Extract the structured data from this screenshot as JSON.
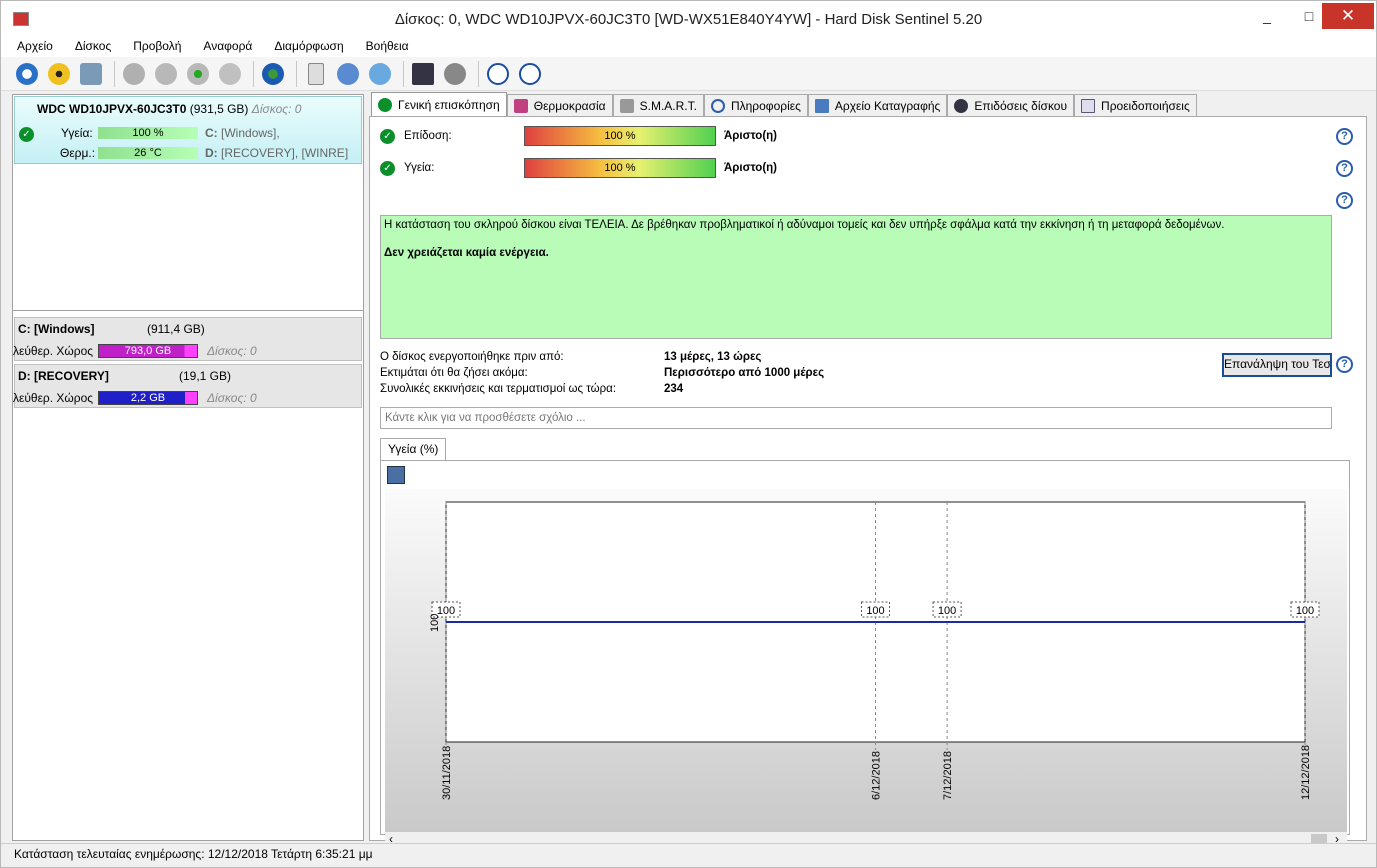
{
  "window": {
    "title": "Δίσκος: 0, WDC WD10JPVX-60JC3T0 [WD-WX51E840Y4YW]  -  Hard Disk Sentinel 5.20",
    "min": "_",
    "max": "□",
    "close": "✕"
  },
  "menu": [
    "Αρχείο",
    "Δίσκος",
    "Προβολή",
    "Αναφορά",
    "Διαμόρφωση",
    "Βοήθεια"
  ],
  "disk": {
    "name": "WDC WD10JPVX-60JC3T0",
    "size": "(931,5 GB)",
    "index": "Δίσκος: 0",
    "health_label": "Υγεία:",
    "health_value": "100 %",
    "temp_label": "Θερμ.:",
    "temp_value": "26 °C",
    "vol_c": "C:",
    "vol_c_name": "[Windows],",
    "vol_d": "D:",
    "vol_d_name": "[RECOVERY],  [WINRE]"
  },
  "partitions": [
    {
      "name": "C: [Windows]",
      "size": "(911,4 GB)",
      "free_label": "λεύθερ. Χώρος",
      "free": "793,0 GB",
      "disk": "Δίσκος: 0",
      "fill": 0.87,
      "color": "#c020c8"
    },
    {
      "name": "D: [RECOVERY]",
      "size": "(19,1 GB)",
      "free_label": "λεύθερ. Χώρος",
      "free": "2,2 GB",
      "disk": "Δίσκος: 0",
      "fill": 0.88,
      "color": "#2020c8"
    }
  ],
  "tabs": [
    "Γενική επισκόπηση",
    "Θερμοκρασία",
    "S.M.A.R.T.",
    "Πληροφορίες",
    "Αρχείο Καταγραφής",
    "Επιδόσεις δίσκου",
    "Προειδοποιήσεις"
  ],
  "overview": {
    "perf_label": "Επίδοση:",
    "perf_value": "100 %",
    "perf_rating": "Άριστο(η)",
    "health_label": "Υγεία:",
    "health_value": "100 %",
    "health_rating": "Άριστο(η)",
    "message": "Η κατάσταση του σκληρού δίσκου είναι ΤΕΛΕΙΑ. Δε βρέθηκαν προβληματικοί ή αδύναμοι τομείς και δεν υπήρξε σφάλμα κατά την εκκίνηση ή τη μεταφορά δεδομένων.",
    "action": "Δεν χρειάζεται καμία ενέργεια.",
    "powered_label": "Ο δίσκος ενεργοποιήθηκε πριν από:",
    "powered_value": "13 μέρες, 13 ώρες",
    "remaining_label": "Εκτιμάται ότι θα ζήσει ακόμα:",
    "remaining_value": "Περισσότερο από 1000 μέρες",
    "starts_label": "Συνολικές εκκινήσεις και τερματισμοί ως τώρα:",
    "starts_value": "234",
    "repeat_button": "Επανάληψη του Τεστ",
    "comment_placeholder": "Κάντε κλικ για να προσθέσετε σχόλιο ..."
  },
  "chart_tab": "Υγεία (%)",
  "chart_data": {
    "type": "line",
    "x": [
      "30/11/2018",
      "6/12/2018",
      "7/12/2018",
      "12/12/2018"
    ],
    "series": [
      {
        "values": [
          100,
          100,
          100,
          100
        ]
      }
    ],
    "ylabel": "100",
    "color": "#1a2aa8"
  },
  "status": "Κατάσταση τελευταίας ενημέρωσης: 12/12/2018 Τετάρτη 6:35:21 μμ"
}
